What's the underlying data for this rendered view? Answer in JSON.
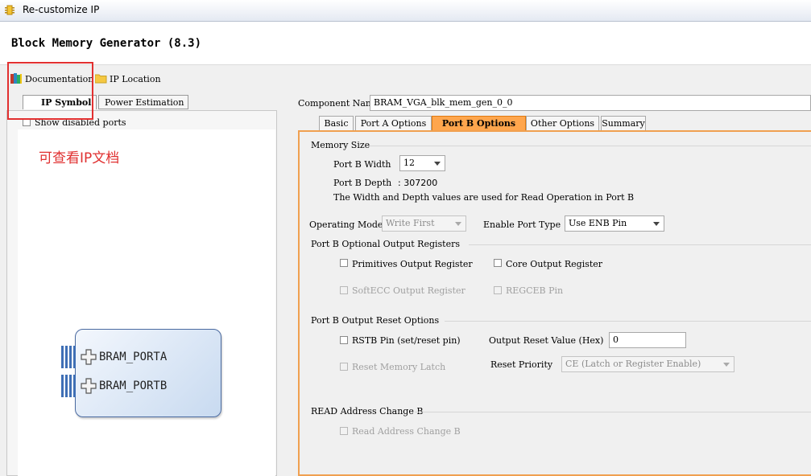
{
  "window": {
    "title": "Re-customize IP"
  },
  "header": {
    "title": "Block Memory Generator (8.3)"
  },
  "toolbar": {
    "documentation": "Documentation",
    "ip_location": "IP Location"
  },
  "left": {
    "tabs": [
      "IP Symbol",
      "Power Estimation"
    ],
    "show_disabled_ports": "Show disabled ports",
    "ports": [
      "BRAM_PORTA",
      "BRAM_PORTB"
    ]
  },
  "annotation": "可查看IP文档",
  "component": {
    "label": "Component Name",
    "value": "BRAM_VGA_blk_mem_gen_0_0"
  },
  "tabs": [
    "Basic",
    "Port A Options",
    "Port B Options",
    "Other Options",
    "Summary"
  ],
  "memory_size": {
    "title": "Memory Size",
    "width_label": "Port B Width",
    "width_value": "12",
    "depth_label": "Port B Depth",
    "depth_value": ": 307200",
    "note": "The Width and Depth values are used for Read Operation in Port B"
  },
  "operating_mode": {
    "label": "Operating Mode",
    "value": "Write First"
  },
  "enable_port": {
    "label": "Enable Port Type",
    "value": "Use ENB Pin"
  },
  "output_registers": {
    "title": "Port B Optional Output Registers",
    "primitives": "Primitives Output Register",
    "core": "Core Output Register",
    "softecc": "SoftECC Output Register",
    "regceb": "REGCEB Pin"
  },
  "reset_options": {
    "title": "Port B Output Reset Options",
    "rstb": "RSTB Pin (set/reset pin)",
    "reset_value_label": "Output Reset Value (Hex)",
    "reset_value": "0",
    "reset_memory_latch": "Reset Memory Latch",
    "reset_priority_label": "Reset Priority",
    "reset_priority_value": "CE (Latch or Register Enable)"
  },
  "read_address": {
    "title": "READ Address Change B",
    "option": "Read Address Change B"
  },
  "colors": {
    "active_tab": "#ffa64d",
    "annotation": "#e03030",
    "highlight": "#e23030"
  }
}
